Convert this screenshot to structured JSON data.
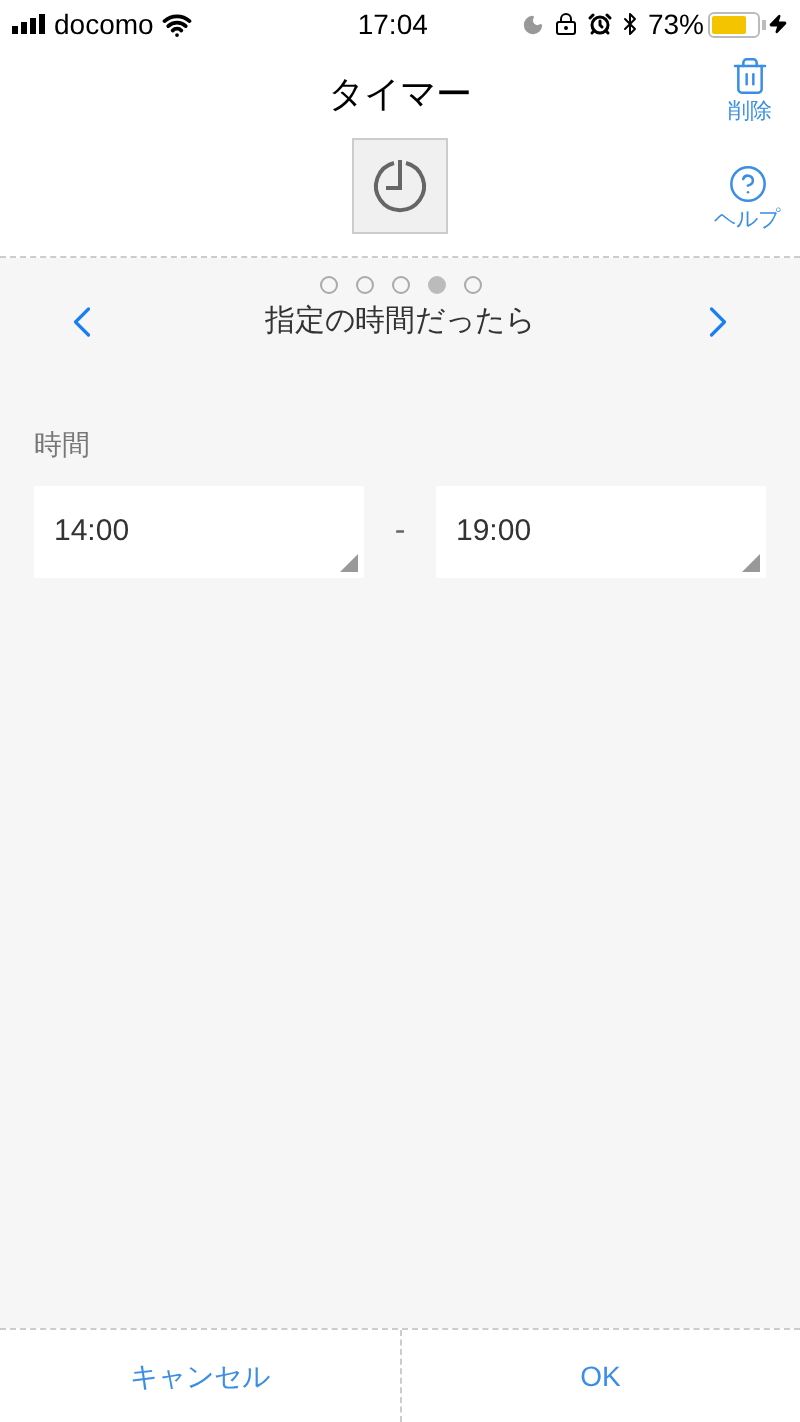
{
  "status_bar": {
    "carrier": "docomo",
    "time": "17:04",
    "battery": "73%"
  },
  "header": {
    "title": "タイマー",
    "delete": "削除",
    "help": "ヘルプ"
  },
  "pager": [
    {
      "selected": false
    },
    {
      "selected": false
    },
    {
      "selected": false
    },
    {
      "selected": true
    },
    {
      "selected": false
    }
  ],
  "condition": {
    "title": "指定の時間だったら"
  },
  "time": {
    "label": "時間",
    "from": "14:00",
    "separator": "-",
    "to": "19:00"
  },
  "footer": {
    "cancel": "キャンセル",
    "ok": "OK"
  }
}
